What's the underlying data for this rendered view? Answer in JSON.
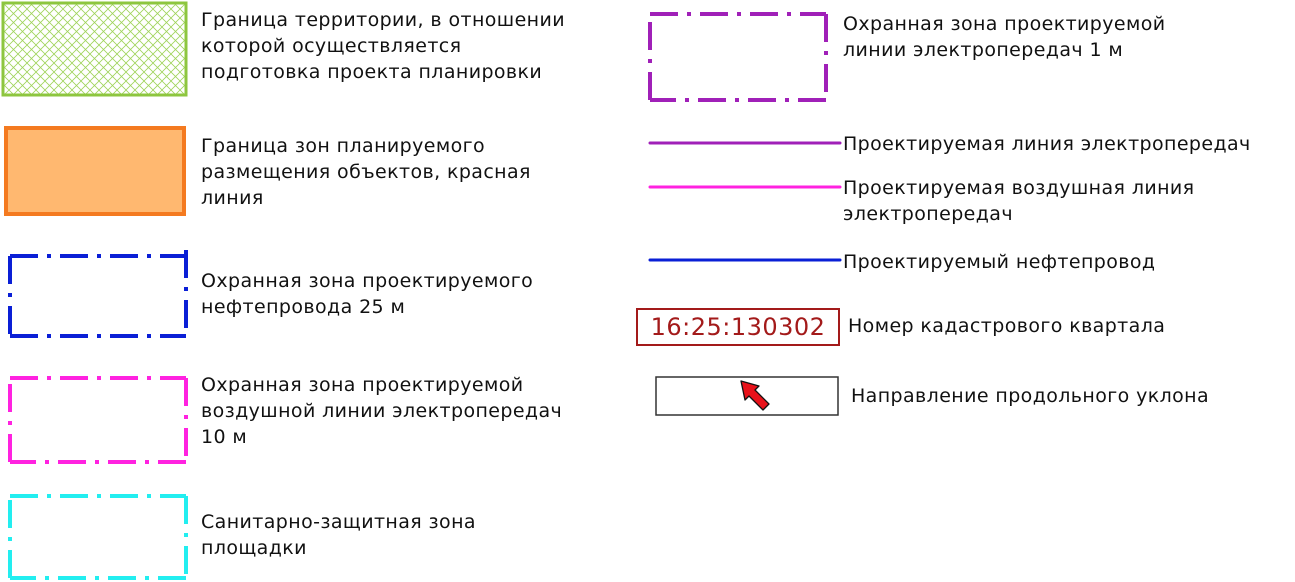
{
  "legend_left": [
    {
      "id": "territory",
      "text": "Граница территории, в отношении\nкоторой осуществляется\nподготовка проекта планировки",
      "swatch": "hatch-rect",
      "stroke": "#8dc63f"
    },
    {
      "id": "zones",
      "text": "Граница зон планируемого\nразмещения объектов, красная\nлиния",
      "swatch": "fill-rect",
      "stroke": "#f47a20",
      "fill": "#ffb870"
    },
    {
      "id": "oil-zone",
      "text": "Охранная зона проектируемого\nнефтепровода 25 м",
      "swatch": "dashdot-rect",
      "stroke": "#0a1fd6"
    },
    {
      "id": "air-line-zone",
      "text": "Охранная зона проектируемой\nвоздушной линии электропередач\n10 м",
      "swatch": "dashdot-rect",
      "stroke": "#ff22e0"
    },
    {
      "id": "sanitary-zone",
      "text": "Санитарно-защитная зона\nплощадки",
      "swatch": "dashdot-rect",
      "stroke": "#22eef0"
    }
  ],
  "legend_right": [
    {
      "id": "power-zone",
      "text": "Охранная зона проектируемой\nлинии электропередач 1 м",
      "swatch": "dashdot-rect",
      "stroke": "#a020b8"
    },
    {
      "id": "power-line",
      "text": "Проектируемая линия электропередач",
      "swatch": "line",
      "stroke": "#a020b8"
    },
    {
      "id": "air-power-line",
      "text": "Проектируемая воздушная линия\nэлектропередач",
      "swatch": "line",
      "stroke": "#ff22e0"
    },
    {
      "id": "oil-line",
      "text": "Проектируемый нефтепровод",
      "swatch": "line",
      "stroke": "#0a1fd6"
    },
    {
      "id": "cadastral",
      "text": "Номер кадастрового квартала",
      "swatch": "cadastral-box",
      "stroke": "#a31a1a",
      "sample": "16:25:130302"
    },
    {
      "id": "slope",
      "text": "Направление продольного уклона",
      "swatch": "arrow-box",
      "stroke": "#333333",
      "fill": "#e8121a"
    }
  ]
}
